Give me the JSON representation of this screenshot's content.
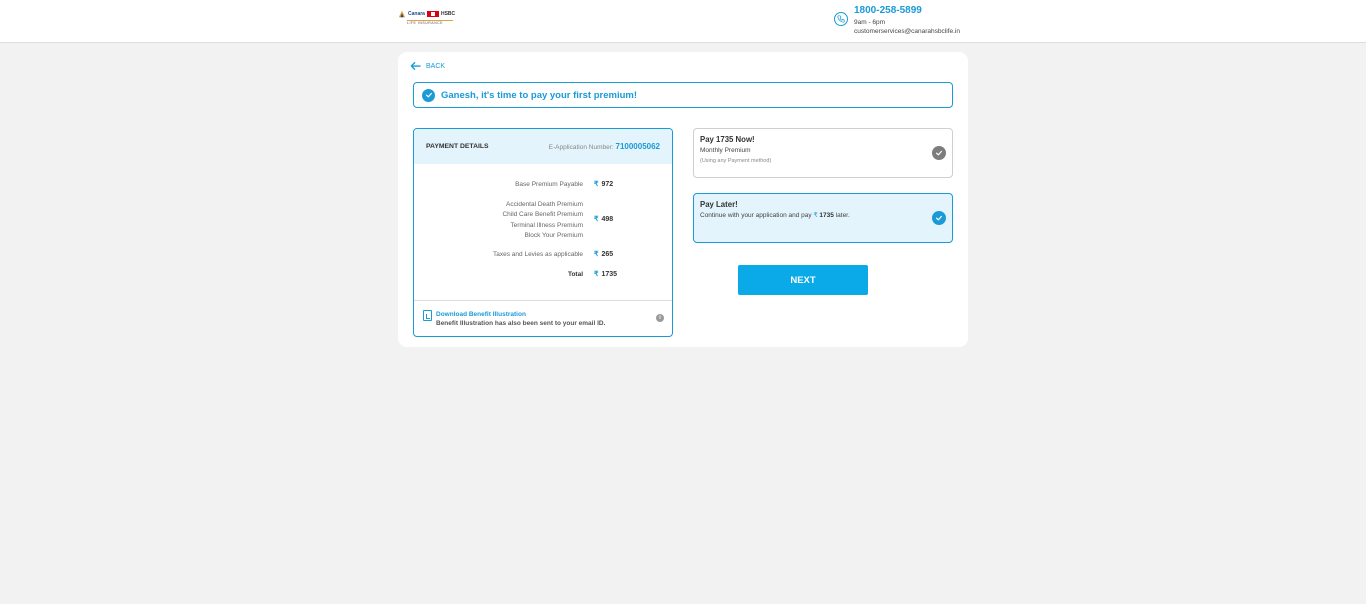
{
  "header": {
    "logo": {
      "brand_left": "Canara",
      "brand_right": "HSBC",
      "tagline": "LIFE INSURANCE"
    },
    "contact": {
      "icon": "phone-icon",
      "phone": "1800-258-5899",
      "hours": "9am - 6pm",
      "email": "customerservices@canarahsbclife.in"
    }
  },
  "nav": {
    "back_label": "BACK",
    "back_icon": "arrow-left-icon"
  },
  "banner": {
    "icon": "check-circle-icon",
    "message": "Ganesh, it's time to pay your first premium!"
  },
  "payment_details": {
    "title": "PAYMENT DETAILS",
    "eapp_label": "E-Application Number:",
    "eapp_number": "7100005062",
    "currency_symbol": "₹",
    "rows": [
      {
        "labels": [
          "Base Premium Payable"
        ],
        "value": "972"
      },
      {
        "labels": [
          "Accidental Death Premium",
          "Child Care Benefit Premium",
          "Terminal Illness Premium",
          "Block Your Premium"
        ],
        "value": "498"
      },
      {
        "labels": [
          "Taxes and Levies as applicable"
        ],
        "value": "265"
      },
      {
        "labels": [
          "Total"
        ],
        "value": "1735"
      }
    ],
    "download": {
      "icon": "document-download-icon",
      "link_label": "Download Benefit Illustration",
      "note": "Benefit Illustration has also been sent to your email ID.",
      "info_icon": "info-icon",
      "info_glyph": "i"
    }
  },
  "options": {
    "pay_now": {
      "title": "Pay 1735 Now!",
      "subtitle": "Monthly Premium",
      "note": "(Using any Payment method)",
      "selected": false
    },
    "pay_later": {
      "title": "Pay Later!",
      "text_before": "Continue with your application and pay",
      "currency_symbol": "₹",
      "amount": "1735",
      "text_after": "later.",
      "selected": true
    }
  },
  "actions": {
    "next_label": "NEXT"
  },
  "colors": {
    "accent": "#1a9ad6",
    "button": "#0aa9e8",
    "highlight_bg": "#e3f4fc",
    "page_bg": "#f2f2f2"
  }
}
